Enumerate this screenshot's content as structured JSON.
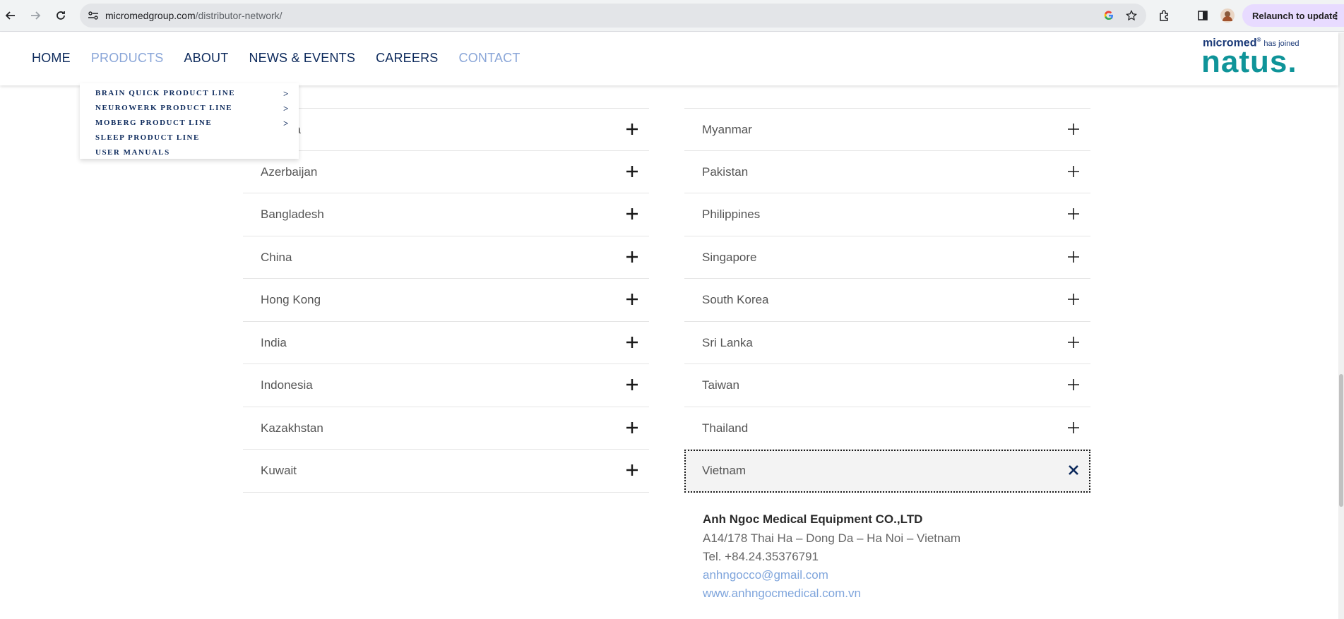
{
  "browser": {
    "url_host": "micromedgroup.com",
    "url_path": "/distributor-network/",
    "relaunch_label": "Relaunch to update"
  },
  "nav": {
    "items": [
      {
        "label": "HOME",
        "active": false
      },
      {
        "label": "PRODUCTS",
        "active": true
      },
      {
        "label": "ABOUT",
        "active": false
      },
      {
        "label": "NEWS & EVENTS",
        "active": false
      },
      {
        "label": "CAREERS",
        "active": false
      },
      {
        "label": "CONTACT",
        "active": true
      }
    ]
  },
  "logo": {
    "brand": "micromed",
    "reg": "®",
    "tagline": "has joined",
    "partner": "natus."
  },
  "products_dropdown": {
    "items": [
      {
        "label": "BRAIN QUICK PRODUCT LINE",
        "arrow": ">"
      },
      {
        "label": "NEUROWERK PRODUCT LINE",
        "arrow": ">"
      },
      {
        "label": "MOBERG PRODUCT LINE",
        "arrow": ">"
      },
      {
        "label": "SLEEP PRODUCT LINE",
        "arrow": ""
      },
      {
        "label": "USER MANUALS",
        "arrow": ""
      }
    ]
  },
  "countries_left": [
    {
      "name": "Australia",
      "visible_text": "lia"
    },
    {
      "name": "Azerbaijan"
    },
    {
      "name": "Bangladesh"
    },
    {
      "name": "China"
    },
    {
      "name": "Hong Kong"
    },
    {
      "name": "India"
    },
    {
      "name": "Indonesia"
    },
    {
      "name": "Kazakhstan"
    },
    {
      "name": "Kuwait"
    }
  ],
  "countries_right": [
    {
      "name": "Myanmar"
    },
    {
      "name": "Pakistan"
    },
    {
      "name": "Philippines"
    },
    {
      "name": "Singapore"
    },
    {
      "name": "South Korea"
    },
    {
      "name": "Sri Lanka"
    },
    {
      "name": "Taiwan"
    },
    {
      "name": "Thailand"
    },
    {
      "name": "Vietnam",
      "open": true
    }
  ],
  "vietnam_detail": {
    "company": "Anh Ngoc Medical Equipment CO.,LTD",
    "address": "A14/178 Thai Ha – Dong Da – Ha Noi – Vietnam",
    "tel": "Tel. +84.24.35376791",
    "email": "anhngocco@gmail.com",
    "website": "www.anhngocmedical.com.vn"
  },
  "colors": {
    "nav_text": "#0d2a5c",
    "nav_active": "#8aa6d8",
    "natus_teal": "#0f9499",
    "link": "#7fa5dc"
  }
}
